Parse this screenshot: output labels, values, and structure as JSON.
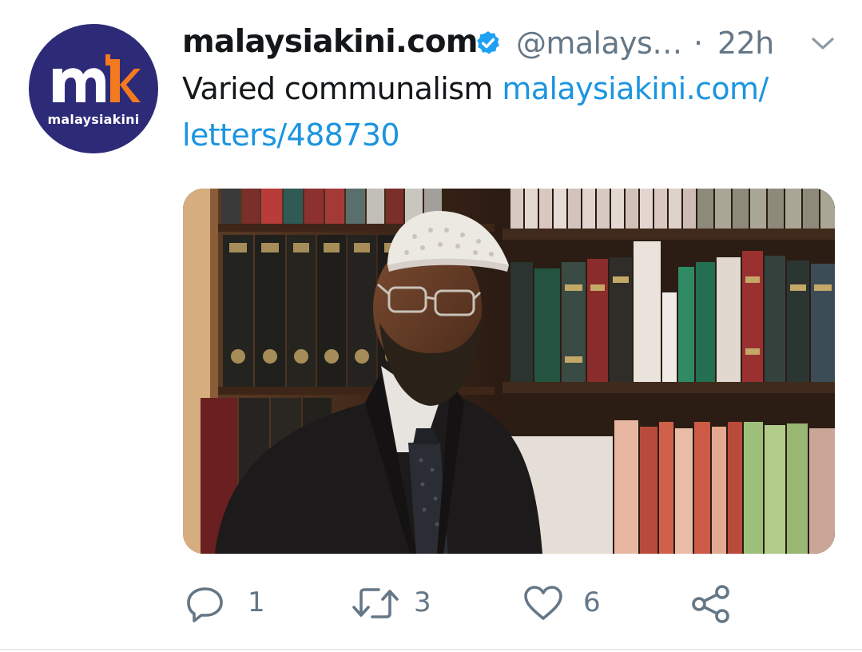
{
  "avatar": {
    "wordmark": "malaysiakini",
    "brand_color": "#2d2a78",
    "accent_color": "#f47a20"
  },
  "author": {
    "display_name": "malaysiakini.com",
    "verified_icon": "verified-badge-icon",
    "handle": "@malays…",
    "separator": "·",
    "time": "22h"
  },
  "tweet": {
    "text": "Varied communalism ",
    "link_line1": "malaysiakini.com/",
    "link_line2": "letters/488730"
  },
  "media": {
    "description_icon": "photo"
  },
  "actions": {
    "reply": {
      "icon": "reply-icon",
      "count": "1"
    },
    "retweet": {
      "icon": "retweet-icon",
      "count": "3"
    },
    "like": {
      "icon": "heart-icon",
      "count": "6"
    },
    "share": {
      "icon": "share-icon"
    }
  },
  "colors": {
    "text": "#14171a",
    "secondary": "#657786",
    "link": "#1b95e0",
    "verified": "#1da1f2"
  }
}
